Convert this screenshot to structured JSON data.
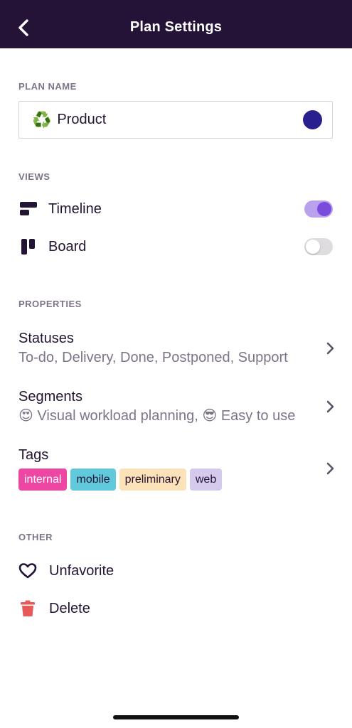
{
  "header": {
    "title": "Plan Settings",
    "back_icon": "chevron-left-icon"
  },
  "plan_name": {
    "section_label": "PLAN NAME",
    "emoji": "♻️",
    "value": "Product",
    "color": "#2a1f8f"
  },
  "views": {
    "section_label": "VIEWS",
    "items": [
      {
        "label": "Timeline",
        "icon": "timeline-icon",
        "enabled": true
      },
      {
        "label": "Board",
        "icon": "board-icon",
        "enabled": false
      }
    ]
  },
  "properties": {
    "section_label": "PROPERTIES",
    "statuses": {
      "title": "Statuses",
      "summary": "To-do, Delivery, Done, Postponed, Support"
    },
    "segments": {
      "title": "Segments",
      "summary": "😍 Visual workload planning, 😎 Easy to use"
    },
    "tags": {
      "title": "Tags",
      "items": [
        {
          "label": "internal",
          "color": "#ee47a3",
          "text_color": "#ffffff"
        },
        {
          "label": "mobile",
          "color": "#61c9dc",
          "text_color": "#241433"
        },
        {
          "label": "preliminary",
          "color": "#fbe2b8",
          "text_color": "#241433"
        },
        {
          "label": "web",
          "color": "#d5c9ec",
          "text_color": "#241433"
        }
      ]
    }
  },
  "other": {
    "section_label": "OTHER",
    "unfavorite": {
      "label": "Unfavorite",
      "icon": "heart-outline-icon"
    },
    "delete": {
      "label": "Delete",
      "icon": "trash-icon",
      "color": "#e65a5a"
    }
  },
  "colors": {
    "header_bg": "#251337",
    "accent": "#7b4cdc"
  }
}
